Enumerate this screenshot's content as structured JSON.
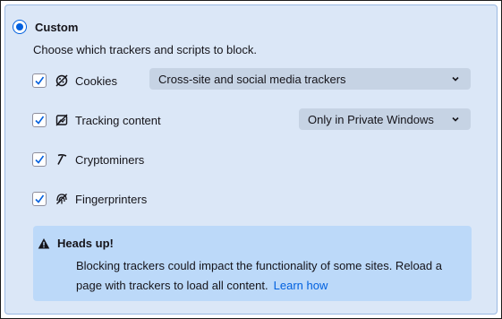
{
  "custom": {
    "label": "Custom",
    "description": "Choose which trackers and scripts to block."
  },
  "options": [
    {
      "label": "Cookies",
      "icon": "cookie-icon",
      "checked": true,
      "select": "Cross-site and social media trackers"
    },
    {
      "label": "Tracking content",
      "icon": "tracking-content-icon",
      "checked": true,
      "select": "Only in Private Windows"
    },
    {
      "label": "Cryptominers",
      "icon": "cryptominer-icon",
      "checked": true
    },
    {
      "label": "Fingerprinters",
      "icon": "fingerprint-icon",
      "checked": true
    }
  ],
  "notice": {
    "title": "Heads up!",
    "body": "Blocking trackers could impact the functionality of some sites. Reload a page with trackers to load all content.",
    "link": "Learn how"
  },
  "colors": {
    "accent": "#0060df",
    "panel": "#dbe7f7",
    "notice": "#bcd9f9"
  }
}
